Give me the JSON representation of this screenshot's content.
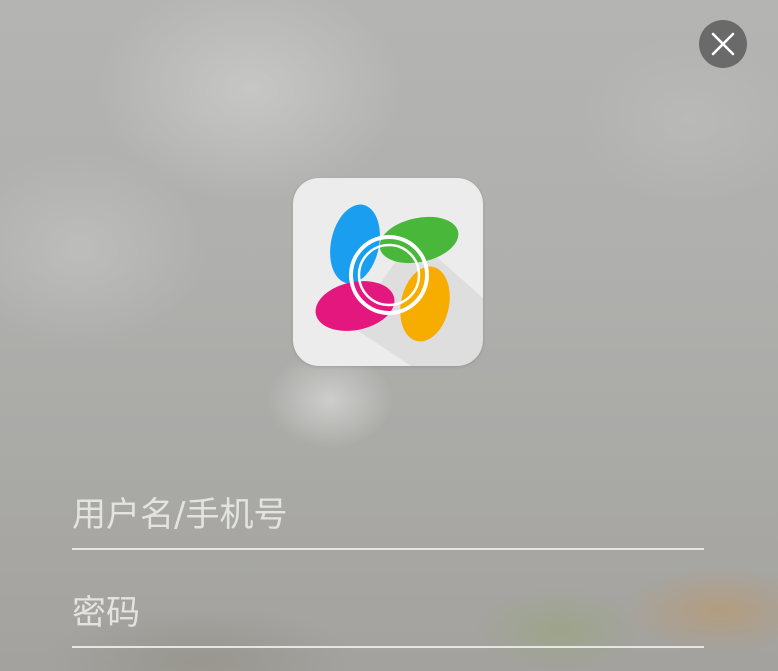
{
  "header": {
    "close_icon": "close-icon"
  },
  "logo": {
    "icon": "ezviz-petals-logo",
    "colors": {
      "blue": "#1a9ff0",
      "green": "#49b83a",
      "magenta": "#e4177e",
      "orange": "#f7ac00",
      "tile": "#ececec"
    }
  },
  "form": {
    "username": {
      "value": "",
      "placeholder": "用户名/手机号"
    },
    "password": {
      "value": "",
      "placeholder": "密码"
    }
  },
  "theme": {
    "background": "#afafad",
    "close_bg": "#646464",
    "underline": "#eeeeec"
  }
}
